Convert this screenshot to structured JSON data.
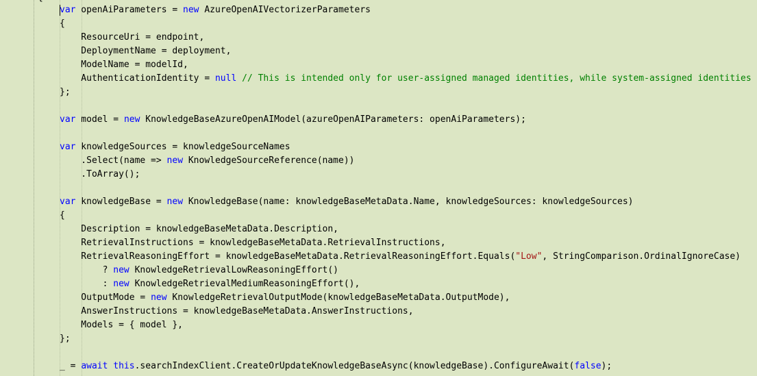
{
  "editor": {
    "top_brace": "{",
    "lines": [
      [
        {
          "t": "var",
          "k": "kw"
        },
        {
          "t": " openAiParameters = ",
          "k": "pl"
        },
        {
          "t": "new",
          "k": "kw"
        },
        {
          "t": " AzureOpenAIVectorizerParameters",
          "k": "pl"
        }
      ],
      [
        {
          "t": "{",
          "k": "pl"
        }
      ],
      [
        {
          "t": "    ResourceUri = endpoint,",
          "k": "pl"
        }
      ],
      [
        {
          "t": "    DeploymentName = deployment,",
          "k": "pl"
        }
      ],
      [
        {
          "t": "    ModelName = modelId,",
          "k": "pl"
        }
      ],
      [
        {
          "t": "    AuthenticationIdentity = ",
          "k": "pl"
        },
        {
          "t": "null",
          "k": "kw"
        },
        {
          "t": " // This is intended only for user-assigned managed identities, while system-assigned identities",
          "k": "cm"
        }
      ],
      [
        {
          "t": "};",
          "k": "pl"
        }
      ],
      [],
      [
        {
          "t": "var",
          "k": "kw"
        },
        {
          "t": " model = ",
          "k": "pl"
        },
        {
          "t": "new",
          "k": "kw"
        },
        {
          "t": " KnowledgeBaseAzureOpenAIModel(azureOpenAIParameters: openAiParameters);",
          "k": "pl"
        }
      ],
      [],
      [
        {
          "t": "var",
          "k": "kw"
        },
        {
          "t": " knowledgeSources = knowledgeSourceNames",
          "k": "pl"
        }
      ],
      [
        {
          "t": "    .Select(name => ",
          "k": "pl"
        },
        {
          "t": "new",
          "k": "kw"
        },
        {
          "t": " KnowledgeSourceReference(name))",
          "k": "pl"
        }
      ],
      [
        {
          "t": "    .ToArray();",
          "k": "pl"
        }
      ],
      [],
      [
        {
          "t": "var",
          "k": "kw"
        },
        {
          "t": " knowledgeBase = ",
          "k": "pl"
        },
        {
          "t": "new",
          "k": "kw"
        },
        {
          "t": " KnowledgeBase(name: knowledgeBaseMetaData.Name, knowledgeSources: knowledgeSources)",
          "k": "pl"
        }
      ],
      [
        {
          "t": "{",
          "k": "pl"
        }
      ],
      [
        {
          "t": "    Description = knowledgeBaseMetaData.Description,",
          "k": "pl"
        }
      ],
      [
        {
          "t": "    RetrievalInstructions = knowledgeBaseMetaData.RetrievalInstructions,",
          "k": "pl"
        }
      ],
      [
        {
          "t": "    RetrievalReasoningEffort = knowledgeBaseMetaData.RetrievalReasoningEffort.Equals(",
          "k": "pl"
        },
        {
          "t": "\"Low\"",
          "k": "st"
        },
        {
          "t": ", StringComparison.OrdinalIgnoreCase)",
          "k": "pl"
        }
      ],
      [
        {
          "t": "        ? ",
          "k": "pl"
        },
        {
          "t": "new",
          "k": "kw"
        },
        {
          "t": " KnowledgeRetrievalLowReasoningEffort()",
          "k": "pl"
        }
      ],
      [
        {
          "t": "        : ",
          "k": "pl"
        },
        {
          "t": "new",
          "k": "kw"
        },
        {
          "t": " KnowledgeRetrievalMediumReasoningEffort(),",
          "k": "pl"
        }
      ],
      [
        {
          "t": "    OutputMode = ",
          "k": "pl"
        },
        {
          "t": "new",
          "k": "kw"
        },
        {
          "t": " KnowledgeRetrievalOutputMode(knowledgeBaseMetaData.OutputMode),",
          "k": "pl"
        }
      ],
      [
        {
          "t": "    AnswerInstructions = knowledgeBaseMetaData.AnswerInstructions,",
          "k": "pl"
        }
      ],
      [
        {
          "t": "    Models = { model },",
          "k": "pl"
        }
      ],
      [
        {
          "t": "};",
          "k": "pl"
        }
      ],
      [],
      [
        {
          "t": "_ = ",
          "k": "pl"
        },
        {
          "t": "await",
          "k": "kw"
        },
        {
          "t": " ",
          "k": "pl"
        },
        {
          "t": "this",
          "k": "kw"
        },
        {
          "t": ".searchIndexClient.CreateOrUpdateKnowledgeBaseAsync(knowledgeBase).ConfigureAwait(",
          "k": "pl"
        },
        {
          "t": "false",
          "k": "kw"
        },
        {
          "t": ");",
          "k": "pl"
        }
      ]
    ]
  },
  "colors": {
    "background": "#dce6c4",
    "keyword": "#0000ff",
    "comment": "#008000",
    "string": "#a31515",
    "text": "#000000"
  }
}
